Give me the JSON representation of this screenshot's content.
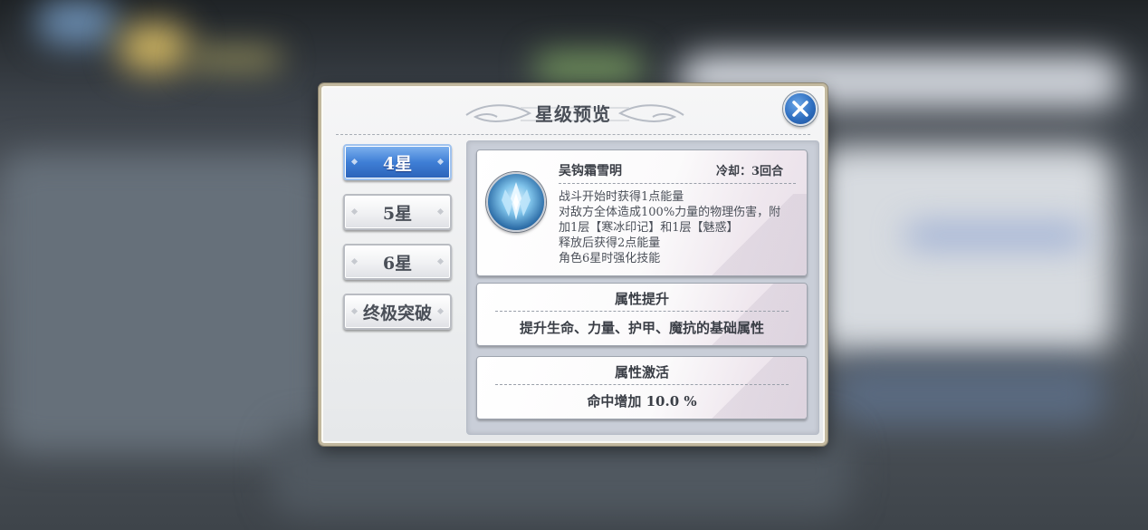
{
  "dialog": {
    "title": "星级预览",
    "close_icon": "close-icon"
  },
  "tabs": [
    {
      "label": "4星",
      "active": true
    },
    {
      "label": "5星",
      "active": false
    },
    {
      "label": "6星",
      "active": false
    },
    {
      "label": "终极突破",
      "active": false
    }
  ],
  "skill": {
    "name": "吴钩霜雪明",
    "cooldown": "冷却：3回合",
    "icon": "ice-crystal-icon",
    "description": [
      "战斗开始时获得1点能量",
      "对敌方全体造成100%力量的物理伤害，附",
      "加1层【寒冰印记】和1层【魅惑】",
      "释放后获得2点能量",
      "角色6星时强化技能"
    ]
  },
  "attr_boost": {
    "title": "属性提升",
    "value": "提升生命、力量、护甲、魔抗的基础属性"
  },
  "attr_activate": {
    "title": "属性激活",
    "value": "命中增加 10.0 %"
  },
  "colors": {
    "active_tab": "#3f7fd6",
    "frame_gold": "#c2b89e",
    "panel_bg": "#c9ced8"
  }
}
